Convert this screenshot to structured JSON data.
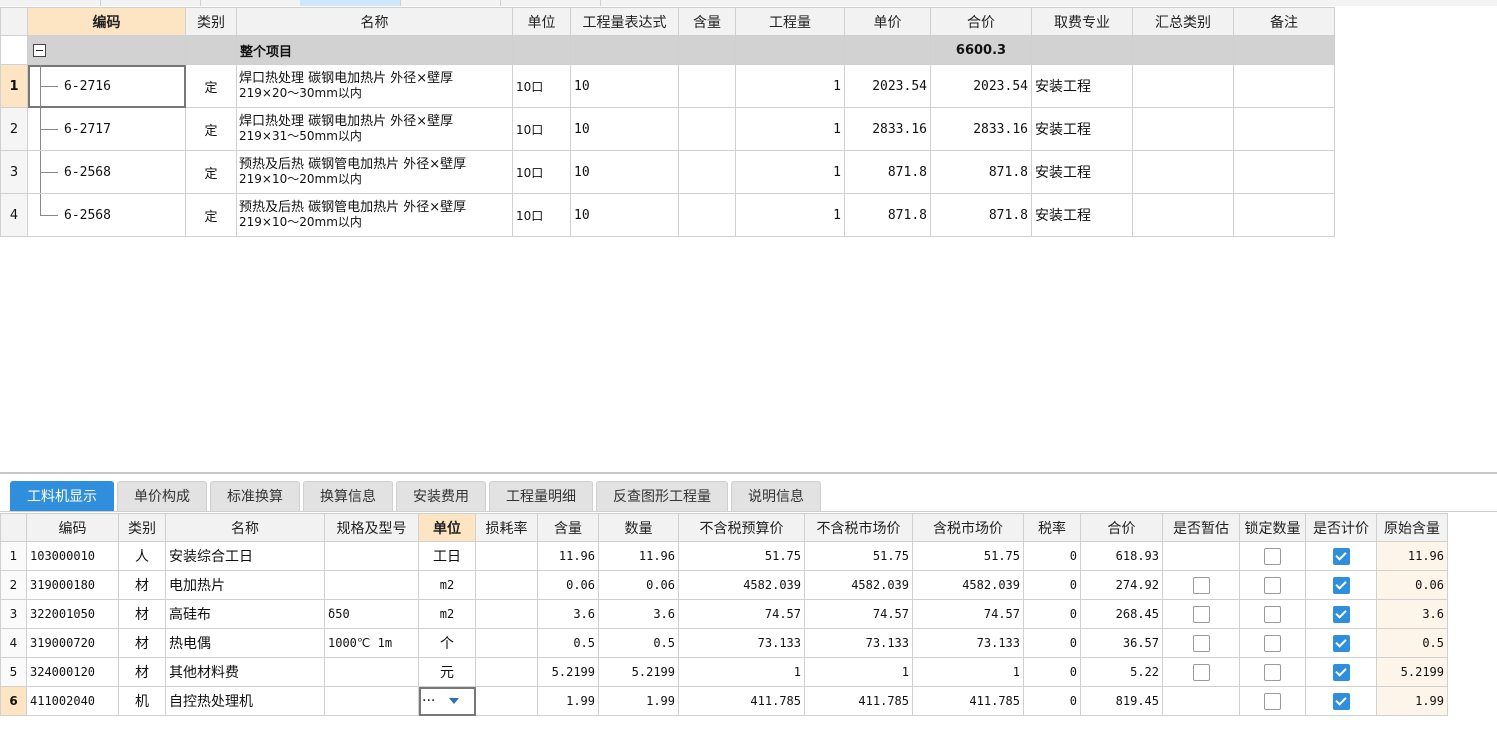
{
  "upper": {
    "headers": [
      "编码",
      "类别",
      "名称",
      "单位",
      "工程量表达式",
      "含量",
      "工程量",
      "单价",
      "合价",
      "取费专业",
      "汇总类别",
      "备注"
    ],
    "summary": {
      "label": "整个项目",
      "total": "6600.3"
    },
    "rows": [
      {
        "num": "1",
        "code": "6-2716",
        "type": "定",
        "name1": "焊口热处理 碳钢电加热片 外径×壁厚",
        "name2": "219×20～30mm以内",
        "unit": "10口",
        "expr": "10",
        "qty": "1",
        "price": "2023.54",
        "total": "2023.54",
        "fee": "安装工程"
      },
      {
        "num": "2",
        "code": "6-2717",
        "type": "定",
        "name1": "焊口热处理 碳钢电加热片 外径×壁厚",
        "name2": "219×31～50mm以内",
        "unit": "10口",
        "expr": "10",
        "qty": "1",
        "price": "2833.16",
        "total": "2833.16",
        "fee": "安装工程"
      },
      {
        "num": "3",
        "code": "6-2568",
        "type": "定",
        "name1": "预热及后热 碳钢管电加热片 外径×壁厚",
        "name2": "219×10～20mm以内",
        "unit": "10口",
        "expr": "10",
        "qty": "1",
        "price": "871.8",
        "total": "871.8",
        "fee": "安装工程"
      },
      {
        "num": "4",
        "code": "6-2568",
        "type": "定",
        "name1": "预热及后热 碳钢管电加热片 外径×壁厚",
        "name2": "219×10～20mm以内",
        "unit": "10口",
        "expr": "10",
        "qty": "1",
        "price": "871.8",
        "total": "871.8",
        "fee": "安装工程"
      }
    ]
  },
  "tabs": [
    "工料机显示",
    "单价构成",
    "标准换算",
    "换算信息",
    "安装费用",
    "工程量明细",
    "反查图形工程量",
    "说明信息"
  ],
  "lower": {
    "headers": [
      "编码",
      "类别",
      "名称",
      "规格及型号",
      "单位",
      "损耗率",
      "含量",
      "数量",
      "不含税预算价",
      "不含税市场价",
      "含税市场价",
      "税率",
      "合价",
      "是否暂估",
      "锁定数量",
      "是否计价",
      "原始含量"
    ],
    "rows": [
      {
        "num": "1",
        "code": "103000010",
        "type": "人",
        "name": "安装综合工日",
        "spec": "",
        "unit": "工日",
        "loss": "",
        "content": "11.96",
        "qty": "11.96",
        "budget": "51.75",
        "market": "51.75",
        "taxmarket": "51.75",
        "tax": "0",
        "total": "618.93",
        "temp": null,
        "lock": false,
        "priced": true,
        "orig": "11.96"
      },
      {
        "num": "2",
        "code": "319000180",
        "type": "材",
        "name": "电加热片",
        "spec": "",
        "unit": "m2",
        "loss": "",
        "content": "0.06",
        "qty": "0.06",
        "budget": "4582.039",
        "market": "4582.039",
        "taxmarket": "4582.039",
        "tax": "0",
        "total": "274.92",
        "temp": false,
        "lock": false,
        "priced": true,
        "orig": "0.06"
      },
      {
        "num": "3",
        "code": "322001050",
        "type": "材",
        "name": "高硅布",
        "spec": "δ50",
        "unit": "m2",
        "loss": "",
        "content": "3.6",
        "qty": "3.6",
        "budget": "74.57",
        "market": "74.57",
        "taxmarket": "74.57",
        "tax": "0",
        "total": "268.45",
        "temp": false,
        "lock": false,
        "priced": true,
        "orig": "3.6"
      },
      {
        "num": "4",
        "code": "319000720",
        "type": "材",
        "name": "热电偶",
        "spec": "1000℃ 1m",
        "unit": "个",
        "loss": "",
        "content": "0.5",
        "qty": "0.5",
        "budget": "73.133",
        "market": "73.133",
        "taxmarket": "73.133",
        "tax": "0",
        "total": "36.57",
        "temp": false,
        "lock": false,
        "priced": true,
        "orig": "0.5"
      },
      {
        "num": "5",
        "code": "324000120",
        "type": "材",
        "name": "其他材料费",
        "spec": "",
        "unit": "元",
        "loss": "",
        "content": "5.2199",
        "qty": "5.2199",
        "budget": "1",
        "market": "1",
        "taxmarket": "1",
        "tax": "0",
        "total": "5.22",
        "temp": false,
        "lock": false,
        "priced": true,
        "orig": "5.2199"
      },
      {
        "num": "6",
        "code": "411002040",
        "type": "机",
        "name": "自控热处理机",
        "spec": "",
        "unit": "···",
        "loss": "",
        "content": "1.99",
        "qty": "1.99",
        "budget": "411.785",
        "market": "411.785",
        "taxmarket": "411.785",
        "tax": "0",
        "total": "819.45",
        "temp": null,
        "lock": false,
        "priced": true,
        "orig": "1.99"
      }
    ]
  },
  "colors": {
    "accent": "#2f8fdc",
    "selectedHeader": "#fde5c3",
    "summaryRow": "#d2d2d2"
  }
}
